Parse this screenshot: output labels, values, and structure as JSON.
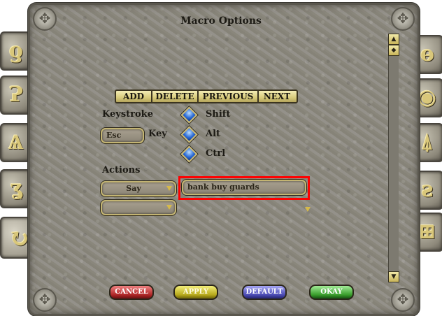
{
  "window": {
    "title": "Macro Options"
  },
  "nav": {
    "add": "ADD",
    "delete": "DELETE",
    "previous": "PREVIOUS",
    "next": "NEXT"
  },
  "keystroke": {
    "label": "Keystroke",
    "key_label": "Key",
    "key_value": "Esc",
    "modifiers": {
      "shift": "Shift",
      "alt": "Alt",
      "ctrl": "Ctrl"
    }
  },
  "actions": {
    "label": "Actions",
    "rows": [
      {
        "action": "Say",
        "argument": "bank buy guards"
      },
      {
        "action": "",
        "argument": ""
      }
    ]
  },
  "buttons": {
    "cancel": "CANCEL",
    "apply": "APPLY",
    "default": "DEFAULT",
    "okay": "OKAY"
  },
  "side_tabs_left": [
    "paperdoll-tab",
    "options-tab",
    "journal-tab",
    "skills-tab",
    "macro-tab"
  ],
  "side_tabs_right": [
    "sound-tab",
    "display-tab",
    "filter-tab",
    "misc-tab",
    "combat-tab"
  ],
  "highlight_color": "#ff0000"
}
